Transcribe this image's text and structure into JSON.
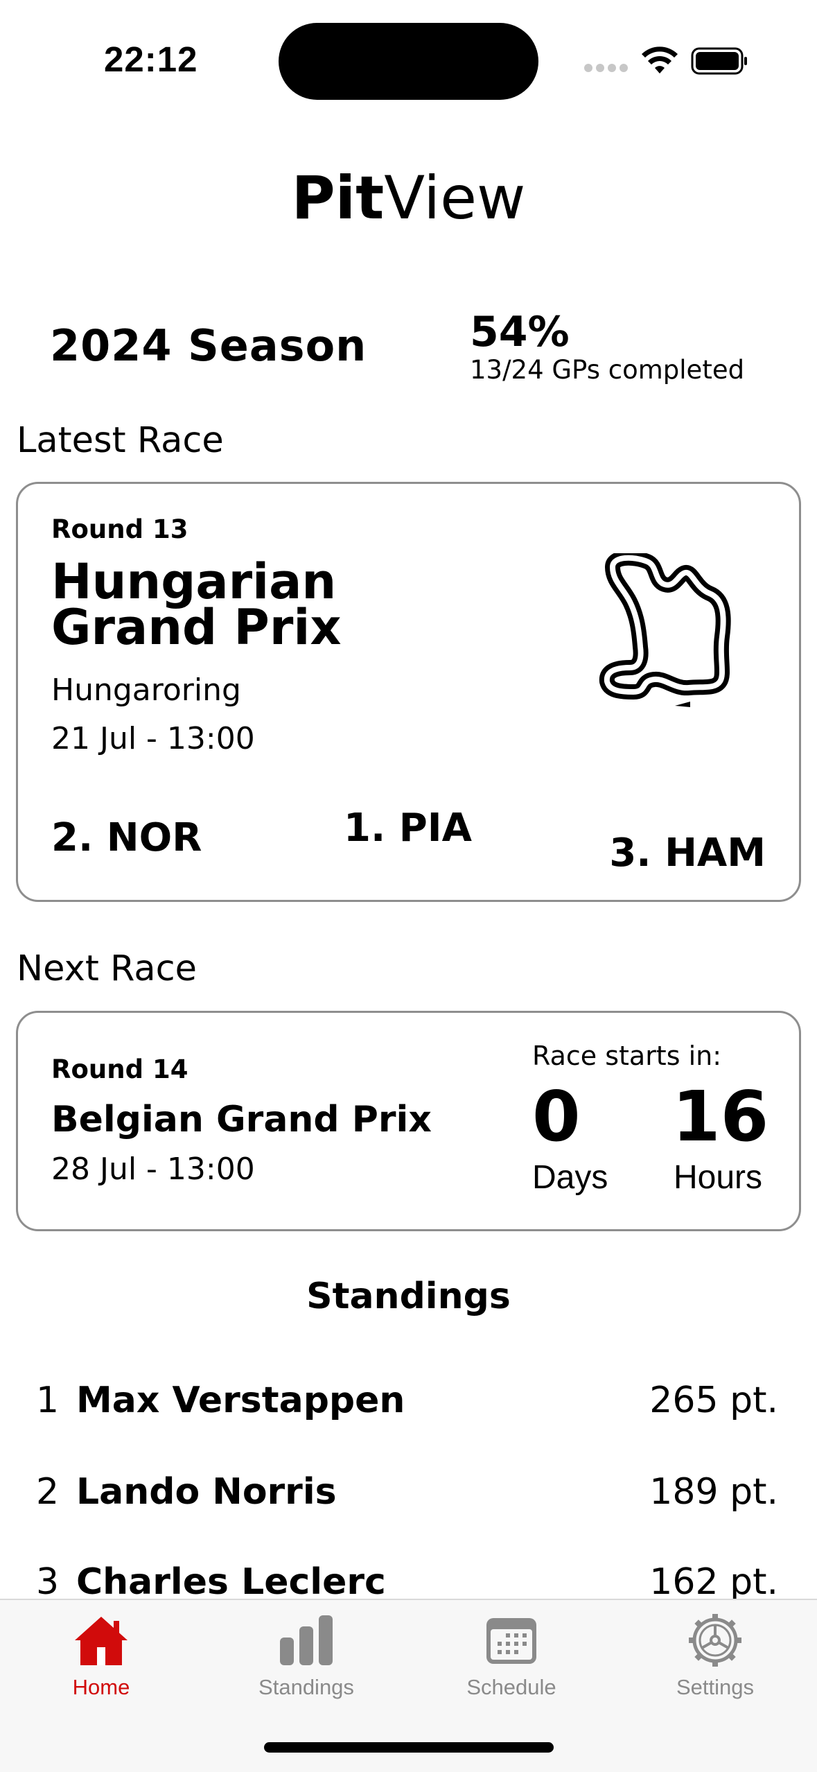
{
  "status": {
    "time": "22:12"
  },
  "header": {
    "title_bold": "Pit",
    "title_light": "View"
  },
  "season": {
    "title": "2024 Season",
    "percent": "54%",
    "progress_text": "13/24 GPs completed"
  },
  "latest": {
    "section_label": "Latest Race",
    "round": "Round 13",
    "name_line1": "Hungarian",
    "name_line2": "Grand Prix",
    "circuit": "Hungaroring",
    "date": "21 Jul - 13:00",
    "podium": {
      "p1": "1. PIA",
      "p2": "2. NOR",
      "p3": "3. HAM"
    },
    "track_icon": "hungaroring-track-icon"
  },
  "next": {
    "section_label": "Next Race",
    "round": "Round 14",
    "name": "Belgian Grand Prix",
    "date": "28 Jul - 13:00",
    "countdown_label": "Race starts in:",
    "days": "0",
    "days_unit": "Days",
    "hours": "16",
    "hours_unit": "Hours"
  },
  "standings": {
    "title": "Standings",
    "rows": [
      {
        "pos": "1",
        "name": "Max Verstappen",
        "points": "265 pt."
      },
      {
        "pos": "2",
        "name": "Lando Norris",
        "points": "189 pt."
      },
      {
        "pos": "3",
        "name": "Charles Leclerc",
        "points": "162 pt."
      }
    ]
  },
  "tabs": [
    {
      "label": "Home",
      "icon": "house-icon",
      "active": true
    },
    {
      "label": "Standings",
      "icon": "bar-chart-icon",
      "active": false
    },
    {
      "label": "Schedule",
      "icon": "calendar-icon",
      "active": false
    },
    {
      "label": "Settings",
      "icon": "gear-icon",
      "active": false
    }
  ],
  "colors": {
    "accent": "#d10b0b",
    "inactive": "#8a8a8a",
    "card_border": "#8e8e8e"
  }
}
